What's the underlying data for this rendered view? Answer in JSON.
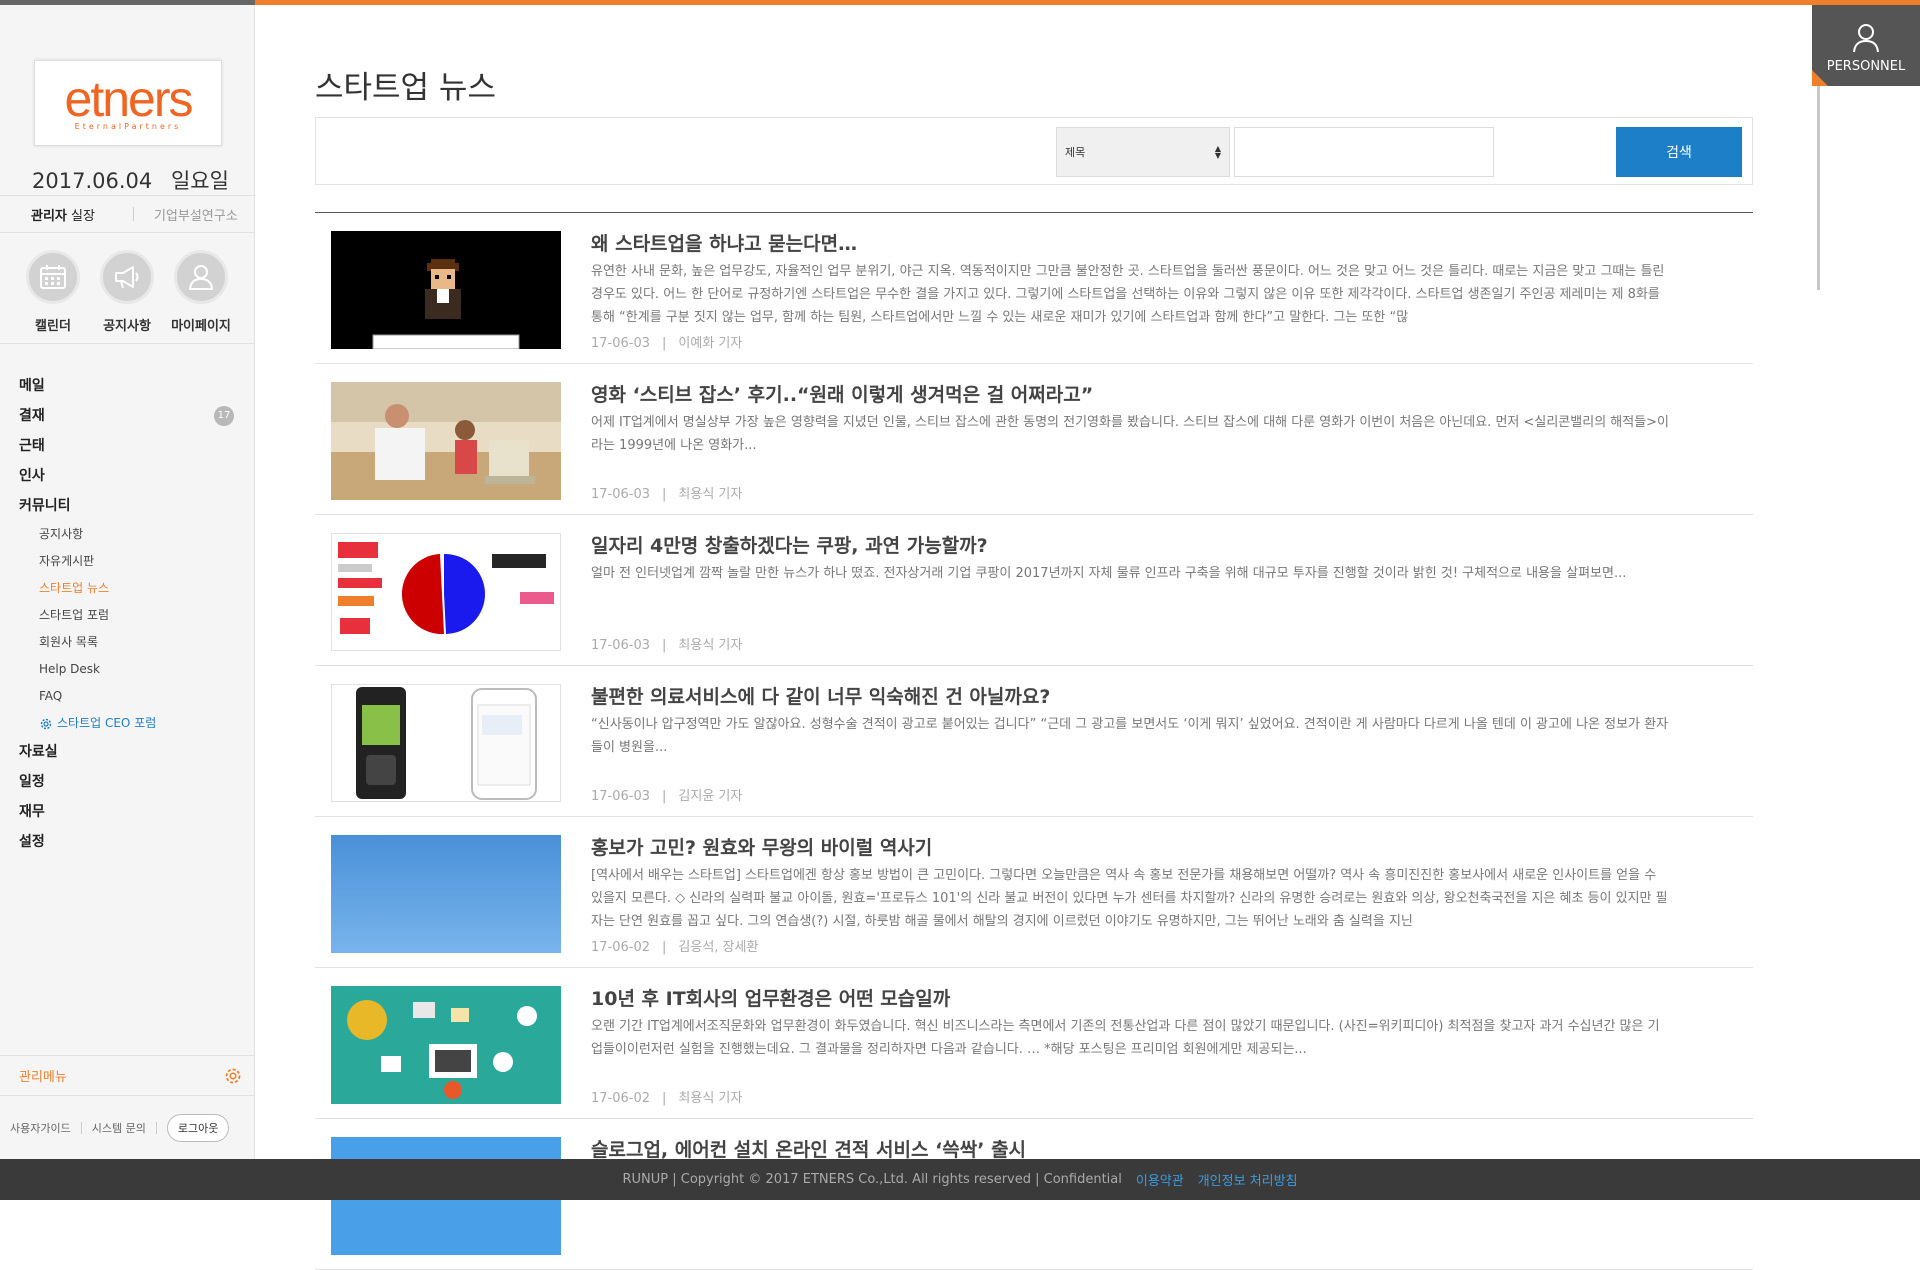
{
  "sidebar": {
    "logo_text": "etners",
    "logo_sub": "EternalPartners",
    "date": "2017.06.04",
    "weekday": "일요일",
    "user_name": "관리자",
    "user_role": "실장",
    "org": "기업부설연구소",
    "quick": [
      {
        "label": "캘린더",
        "icon": "calendar-icon"
      },
      {
        "label": "공지사항",
        "icon": "megaphone-icon"
      },
      {
        "label": "마이페이지",
        "icon": "user-icon"
      }
    ],
    "nav": {
      "mail": "메일",
      "approval": "결재",
      "approval_badge": "17",
      "attendance": "근태",
      "hr": "인사",
      "community": "커뮤니티",
      "sub": {
        "notice": "공지사항",
        "free": "자유게시판",
        "startup_news": "스타트업 뉴스",
        "startup_forum": "스타트업 포럼",
        "members": "회원사 목록",
        "helpdesk": "Help Desk",
        "faq": "FAQ",
        "ceo_forum": "스타트업 CEO 포럼"
      },
      "archive": "자료실",
      "schedule": "일정",
      "finance": "재무",
      "settings": "설정"
    },
    "admin_menu": "관리메뉴",
    "util": {
      "guide": "사용자가이드",
      "inquiry": "시스템 문의",
      "logout": "로그아웃"
    }
  },
  "main": {
    "title": "스타트업 뉴스",
    "search": {
      "select_value": "제목",
      "input_value": "",
      "button": "검색"
    },
    "articles": [
      {
        "title": "왜 스타트업을 하냐고 묻는다면…",
        "summary": "유연한 사내 문화, 높은 업무강도, 자율적인 업무 분위기, 야근 지옥. 역동적이지만 그만큼 불안정한 곳. 스타트업을 둘러싼 풍문이다. 어느 것은 맞고 어느 것은 틀리다. 때로는 지금은 맞고 그때는 틀린 경우도 있다. 어느 한 단어로 규정하기엔 스타트업은 무수한 결을 가지고 있다. 그렇기에 스타트업을 선택하는 이유와 그렇지 않은 이유 또한 제각각이다. 스타트업 생존일기 주인공 제레미는 제 8화를 통해 “한계를 구분 짓지 않는 업무, 함께 하는 팀원, 스타트업에서만 느낄 수 있는 새로운 재미가 있기에 스타트업과 함께 한다”고 말한다. 그는 또한 “많",
        "date": "17-06-03",
        "author": "이예화 기자"
      },
      {
        "title": "영화 ‘스티브 잡스’ 후기..“원래 이렇게 생겨먹은 걸 어쩌라고”",
        "summary": "어제 IT업계에서 명실상부 가장 높은 영향력을 지녔던 인물, 스티브 잡스에 관한 동명의 전기영화를 봤습니다.   스티브 잡스에 대해 다룬 영화가 이번이 처음은 아닌데요.   먼저 <실리콘밸리의 해적들>이라는 1999년에 나온 영화가...",
        "date": "17-06-03",
        "author": "최용식 기자"
      },
      {
        "title": "일자리 4만명 창출하겠다는 쿠팡, 과연 가능할까?",
        "summary": "얼마 전 인터넷업계 깜짝 놀랄 만한 뉴스가 하나 떴죠.   전자상거래 기업 쿠팡이 2017년까지 자체 물류 인프라 구축을 위해 대규모 투자를 진행할 것이라 밝힌 것!     구체적으로 내용을 살펴보면...",
        "date": "17-06-03",
        "author": "최용식 기자"
      },
      {
        "title": "불편한 의료서비스에 다 같이 너무 익숙해진 건 아닐까요?",
        "summary": "“신사동이나 압구정역만 가도 알잖아요. 성형수술 견적이 광고로 붙어있는 겁니다”     “근데 그 광고를 보면서도 ‘이게 뭐지’ 싶었어요. 견적이란 게 사람마다 다르게 나올 텐데 이 광고에 나온 정보가 환자들이 병원을...",
        "date": "17-06-03",
        "author": "김지윤 기자"
      },
      {
        "title": "홍보가 고민? 원효와 무왕의 바이럴 역사기",
        "summary": "[역사에서 배우는 스타트업] 스타트업에겐 항상 홍보 방법이 큰 고민이다. 그렇다면 오늘만큼은 역사 속 홍보 전문가를 채용해보면 어떨까? 역사 속 흥미진진한 홍보사에서 새로운 인사이트를 얻을 수 있을지 모른다. ◇ 신라의 실력파 불교 아이돌, 원효='프로듀스 101'의 신라 불교 버전이 있다면 누가 센터를 차지할까? 신라의 유명한 승려로는 원효와 의상, 왕오천축국전을 지은 혜초 등이 있지만 필자는 단연 원효를 꼽고 싶다. 그의 연습생(?) 시절, 하룻밤 해골 물에서 해탈의 경지에 이르렀던 이야기도 유명하지만, 그는 뛰어난 노래와 춤 실력을 지닌",
        "date": "17-06-02",
        "author": "김응석, 장세환"
      },
      {
        "title": "10년 후 IT회사의 업무환경은 어떤 모습일까",
        "summary": "오랜 기간 IT업계에서조직문화와 업무환경이 화두였습니다. 혁신 비즈니스라는 측면에서 기존의 전통산업과 다른 점이 많았기 때문입니다. (사진=위키피디아) 최적점을 찾고자 과거 수십년간 많은 기업들이이런저런 실험을 진행했는데요. 그 결과물을 정리하자면 다음과 같습니다.   … *해당 포스팅은 프리미엄 회원에게만 제공되는...",
        "date": "17-06-02",
        "author": "최용식 기자"
      },
      {
        "title": "슬로그업, 에어컨 설치 온라인 견적 서비스 ‘쓱싹’ 출시",
        "summary": "",
        "date": "",
        "author": ""
      }
    ]
  },
  "personnel": "PERSONNEL",
  "footer": {
    "copyright": "RUNUP | Copyright © 2017 ETNERS Co.,Ltd. All rights reserved | Confidential",
    "terms": "이용약관",
    "privacy": "개인정보 처리방침"
  },
  "colors": {
    "accent": "#f07f2d",
    "primary": "#1d7fc8",
    "footer_bg": "#3a3a3a"
  }
}
